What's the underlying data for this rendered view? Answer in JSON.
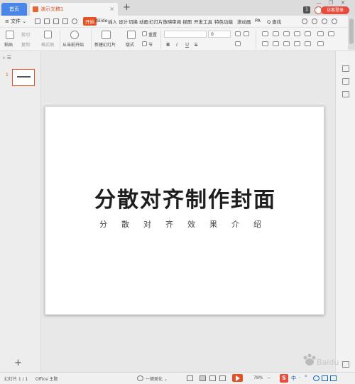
{
  "tabs": {
    "home": "首页",
    "doc": "演示文稿1",
    "close": "×",
    "add": "+"
  },
  "window": {
    "badge": "1",
    "login": "访客登录",
    "minimize": "—",
    "restore": "❐",
    "close": "✕"
  },
  "menu": {
    "file": "≡ 文件 ⌄",
    "items": [
      "开始",
      "iSlide",
      "插入",
      "设计",
      "切换",
      "动画",
      "幻灯片放映",
      "审阅",
      "视图",
      "开发工具",
      "特色功能",
      "滚动画",
      "PA"
    ],
    "search": "Q 查找"
  },
  "ribbon": {
    "paste": "粘贴",
    "cut": "剪切",
    "copy": "复制",
    "format_painter": "格式刷",
    "from_current": "从当前开始",
    "new_slide": "新建幻灯片",
    "layout": "版式",
    "section": "节",
    "reset": "重置",
    "font_size": "0",
    "bold": "B",
    "italic": "I",
    "underline": "U",
    "strike": "S"
  },
  "leftpane": {
    "slide_number": "1",
    "add": "+"
  },
  "slide": {
    "title": "分散对齐制作封面",
    "subtitle": "分散对齐效果介绍"
  },
  "status": {
    "slide_count": "幻灯片 1 / 1",
    "theme": "Office 主题",
    "beautify": "一键美化 ⌄",
    "zoom": "78%",
    "ime_logo": "S",
    "ime_chars": [
      "中",
      "·",
      "°"
    ]
  },
  "watermark": {
    "text": "Baidu 经验"
  },
  "colors": {
    "accent": "#e55325",
    "home_tab": "#4a86e8",
    "login": "#e74c3c"
  }
}
